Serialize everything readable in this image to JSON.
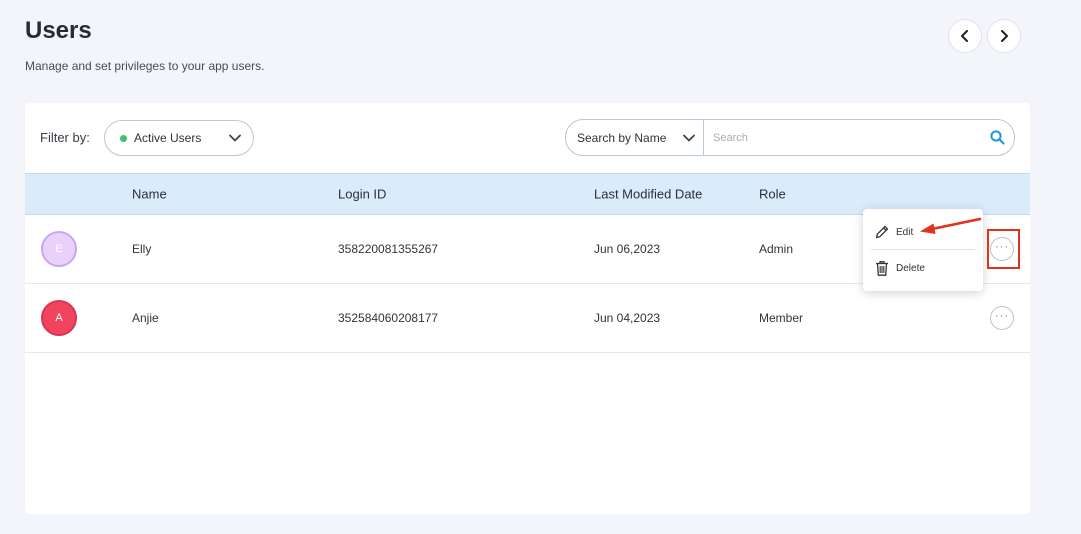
{
  "header": {
    "title": "Users",
    "subtitle": "Manage and set privileges to your app users."
  },
  "nav": {
    "prev_icon": "chevron-left-icon",
    "next_icon": "chevron-right-icon"
  },
  "filter": {
    "label": "Filter by:",
    "selected": "Active Users",
    "status_color": "#3cc36b"
  },
  "search": {
    "type_selected": "Search by Name",
    "value": "",
    "placeholder": "Search",
    "icon": "search-icon",
    "icon_color": "#1e9bd7"
  },
  "table": {
    "columns": [
      "Name",
      "Login ID",
      "Last Modified Date",
      "Role"
    ],
    "rows": [
      {
        "initial": "E",
        "name": "Elly",
        "login_id": "358220081355267",
        "modified": "Jun 06,2023",
        "role": "Admin",
        "more": "···"
      },
      {
        "initial": "A",
        "name": "Anjie",
        "login_id": "352584060208177",
        "modified": "Jun 04,2023",
        "role": "Member",
        "more": "···"
      }
    ]
  },
  "row_menu": {
    "items": [
      {
        "label": "Edit",
        "icon": "pencil-icon"
      },
      {
        "label": "Delete",
        "icon": "trash-icon"
      }
    ]
  },
  "annotation": {
    "color": "#e3321b"
  }
}
